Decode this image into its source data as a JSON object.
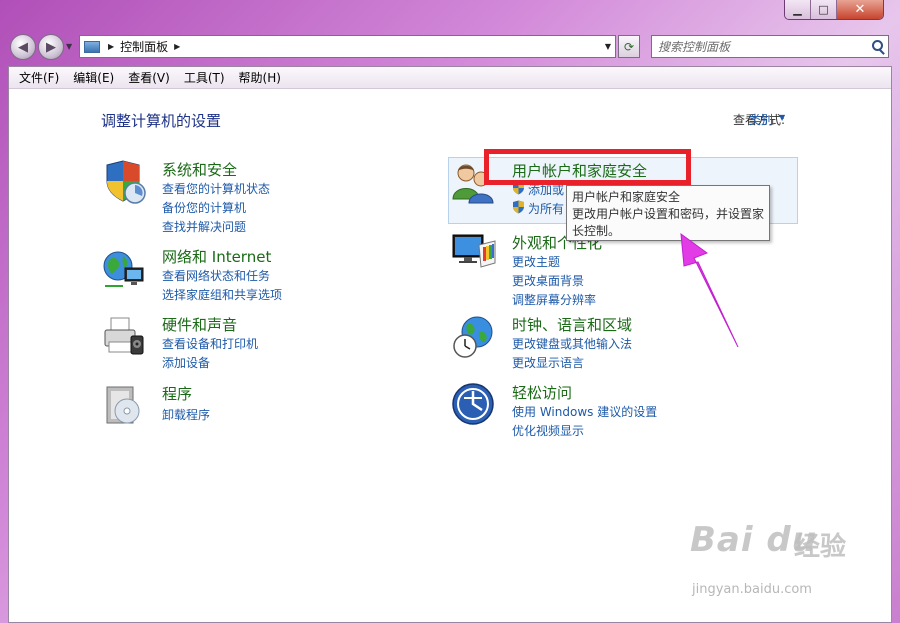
{
  "address": {
    "crumb": "控制面板"
  },
  "search": {
    "placeholder": "搜索控制面板"
  },
  "menu": [
    {
      "label": "文件(F)"
    },
    {
      "label": "编辑(E)"
    },
    {
      "label": "查看(V)"
    },
    {
      "label": "工具(T)"
    },
    {
      "label": "帮助(H)"
    }
  ],
  "page": {
    "title": "调整计算机的设置",
    "view_label": "查看方式:",
    "view_value": "类别"
  },
  "categories": {
    "system": {
      "title": "系统和安全",
      "links": [
        "查看您的计算机状态",
        "备份您的计算机",
        "查找并解决问题"
      ]
    },
    "network": {
      "title": "网络和 Internet",
      "links": [
        "查看网络状态和任务",
        "选择家庭组和共享选项"
      ]
    },
    "hardware": {
      "title": "硬件和声音",
      "links": [
        "查看设备和打印机",
        "添加设备"
      ]
    },
    "programs": {
      "title": "程序",
      "links": [
        "卸载程序"
      ]
    },
    "users": {
      "title": "用户帐户和家庭安全",
      "links": [
        "添加或",
        "为所有"
      ]
    },
    "appearance": {
      "title": "外观和个性化",
      "links": [
        "更改主题",
        "更改桌面背景",
        "调整屏幕分辨率"
      ]
    },
    "clock": {
      "title": "时钟、语言和区域",
      "links": [
        "更改键盘或其他输入法",
        "更改显示语言"
      ]
    },
    "ease": {
      "title": "轻松访问",
      "links": [
        "使用 Windows 建议的设置",
        "优化视频显示"
      ]
    }
  },
  "tooltip": {
    "line1": "用户帐户和家庭安全",
    "line2": "更改用户帐户设置和密码，并设置家长控制。"
  },
  "watermark": {
    "logo": "Bai du",
    "text": "经验",
    "url": "jingyan.baidu.com"
  },
  "colors": {
    "accent": "#1e5aa8",
    "category_title": "#1a6a16",
    "highlight_box": "#e8212a",
    "arrow": "#e23ce6"
  }
}
